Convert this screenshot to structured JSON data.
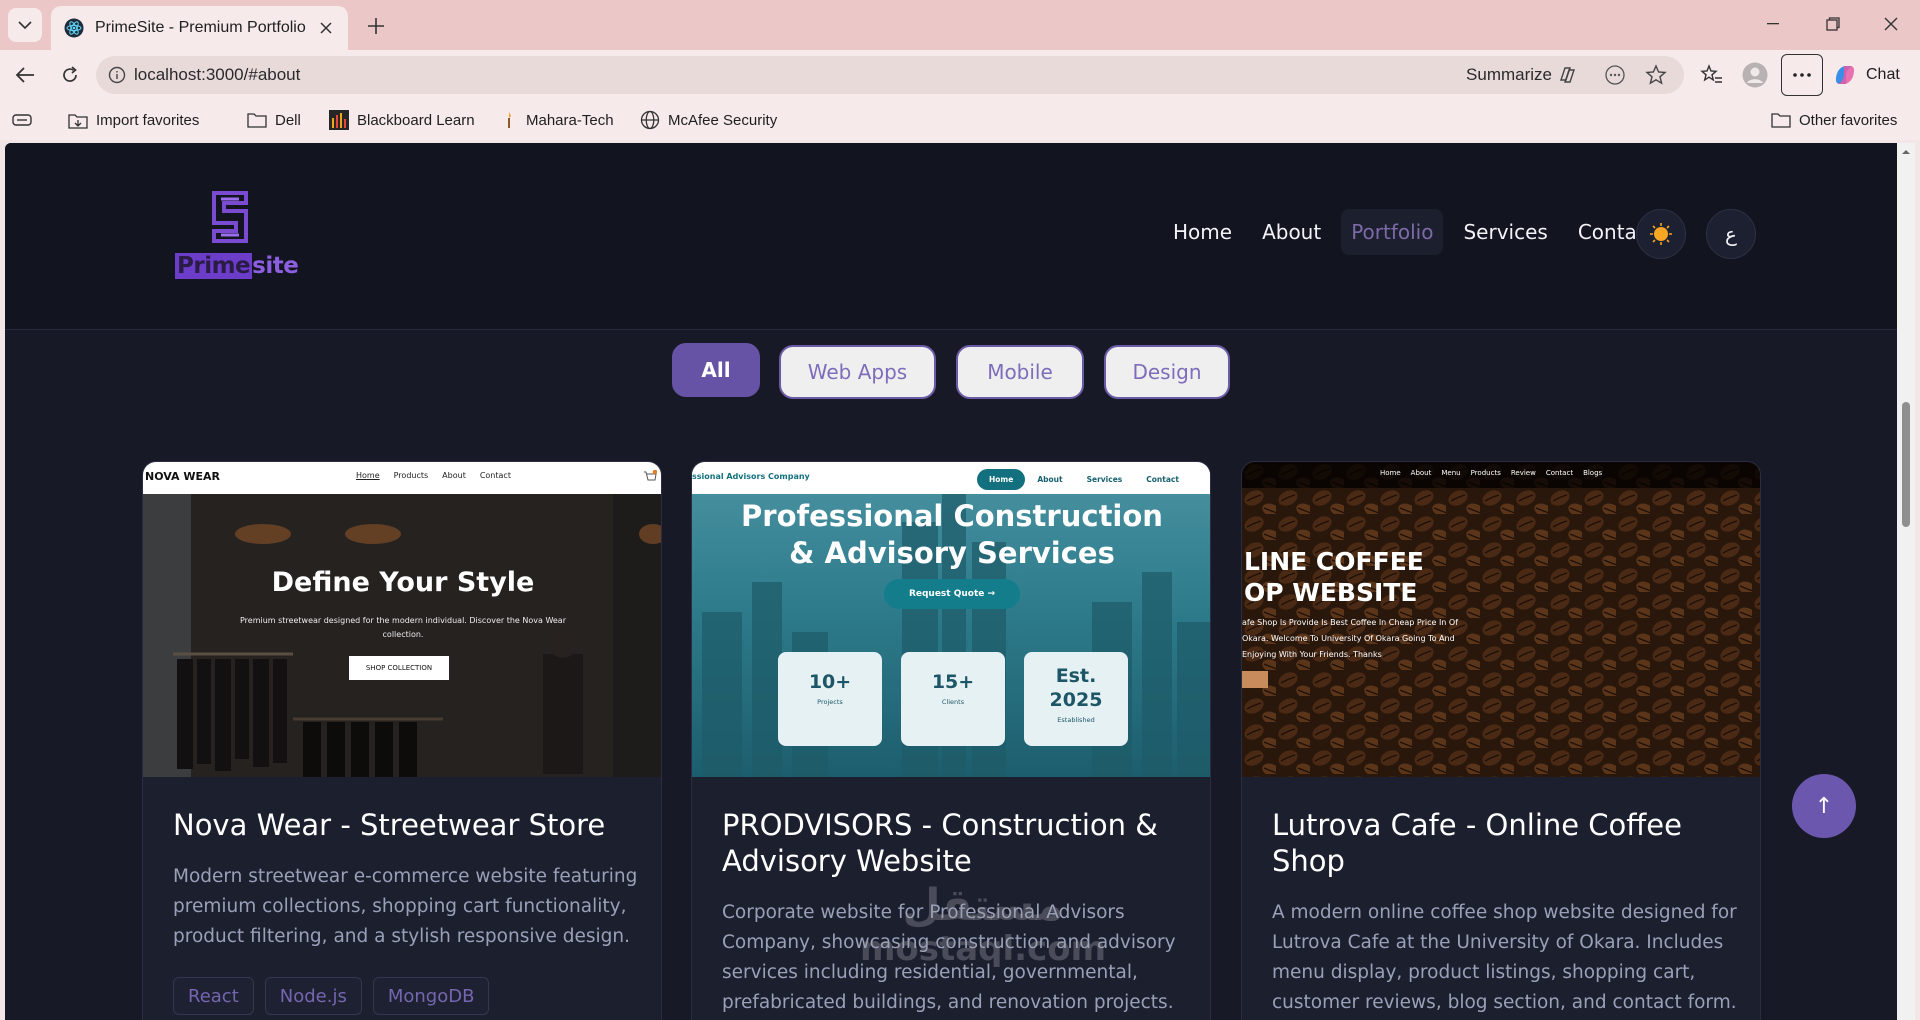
{
  "browser": {
    "tab_title": "PrimeSite - Premium Portfolio",
    "url": "localhost:3000/#about",
    "summarize_label": "Summarize",
    "chat_label": "Chat",
    "bookmarks": [
      "Import favorites",
      "Dell",
      "Blackboard Learn",
      "Mahara-Tech",
      "McAfee Security"
    ],
    "other_favorites": "Other favorites"
  },
  "site": {
    "logo_text_part1": "Prime",
    "logo_text_part2": "site",
    "nav": [
      "Home",
      "About",
      "Portfolio",
      "Services",
      "Contact"
    ],
    "active_nav": "Portfolio",
    "lang_toggle": "ع",
    "filters": [
      "All",
      "Web Apps",
      "Mobile",
      "Design"
    ],
    "active_filter": "All",
    "back_to_top": "↑"
  },
  "projects": [
    {
      "title": "Nova Wear - Streetwear Store",
      "description": "Modern streetwear e-commerce website featuring premium collections, shopping cart functionality, product filtering, and a stylish responsive design.",
      "tags": [
        "React",
        "Node.js",
        "MongoDB"
      ],
      "preview": {
        "brand": "NOVA WEAR",
        "nav": [
          "Home",
          "Products",
          "About",
          "Contact"
        ],
        "headline": "Define Your Style",
        "subtext": "Premium streetwear designed for the modern individual. Discover the Nova Wear collection.",
        "button": "SHOP COLLECTION"
      }
    },
    {
      "title": "PRODVISORS - Construction & Advisory Website",
      "description": "Corporate website for Professional Advisors Company, showcasing construction and advisory services including residential, governmental, prefabricated buildings, and renovation projects.",
      "preview": {
        "brand": "ssional Advisors Company",
        "nav": [
          "Home",
          "About",
          "Services",
          "Contact"
        ],
        "headline_line1": "Professional Construction",
        "headline_line2": "& Advisory Services",
        "button": "Request Quote →",
        "stats": [
          {
            "value": "10+",
            "label": "Projects"
          },
          {
            "value": "15+",
            "label": "Clients"
          },
          {
            "value": "Est. 2025",
            "label": "Established"
          }
        ]
      }
    },
    {
      "title": "Lutrova Cafe - Online Coffee Shop",
      "description": "A modern online coffee shop website designed for Lutrova Cafe at the University of Okara. Includes menu display, product listings, shopping cart, customer reviews, blog section, and contact form.",
      "preview": {
        "nav": [
          "Home",
          "About",
          "Menu",
          "Products",
          "Review",
          "Contact",
          "Blogs"
        ],
        "headline_line1": "LINE COFFEE",
        "headline_line2": "OP WEBSITE",
        "subtext": "afe Shop Is Provide Is Best Coffee In Cheap Price In Of Okara. Welcome To University Of Okara Going To And Enjoying With Your Friends. Thanks"
      }
    }
  ],
  "watermark": {
    "line1": "مستقل",
    "line2": "mostaql.com"
  },
  "colors": {
    "page_bg": "#171a26",
    "card_bg": "#1c1f2e",
    "accent": "#6753a6"
  }
}
